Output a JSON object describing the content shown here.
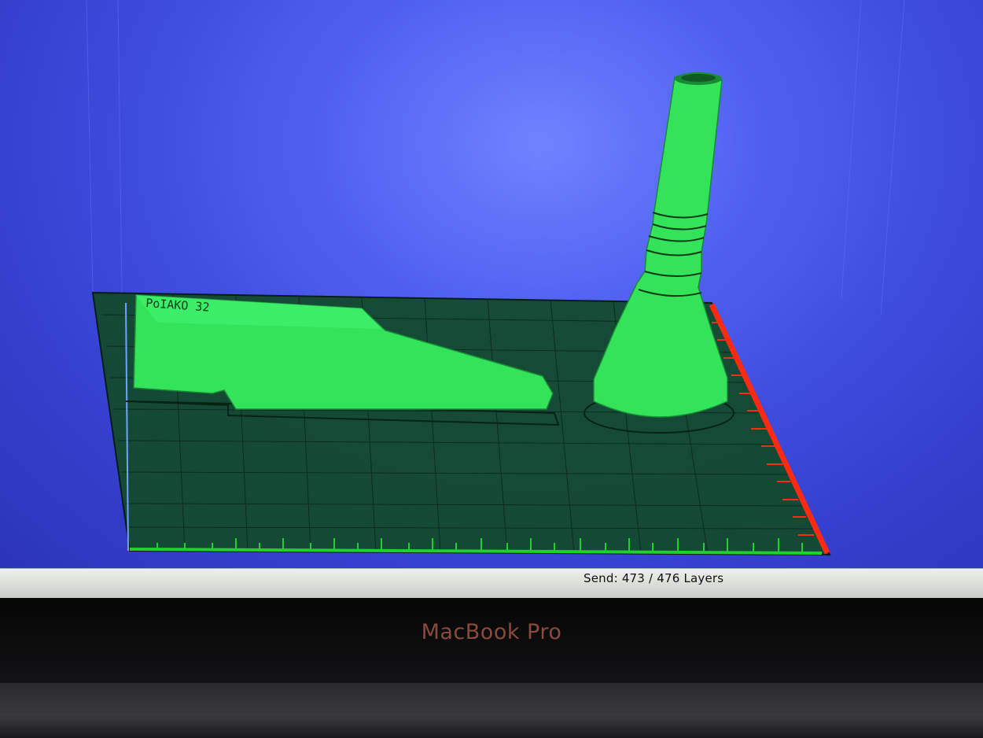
{
  "status": {
    "send_label": "Send:",
    "layers_done": "473",
    "layers_total": "476",
    "layers_unit": "Layers"
  },
  "device": {
    "brand_label": "MacBook Pro"
  },
  "model": {
    "engraved_text": "PoIAKO 32"
  },
  "colors": {
    "model_fill": "#33e35a",
    "bed_fill": "#134a2e",
    "grid_line": "#0b2a1a",
    "x_axis": "#1fd12e",
    "y_axis": "#ff2a12",
    "background": "#3d4ade"
  }
}
